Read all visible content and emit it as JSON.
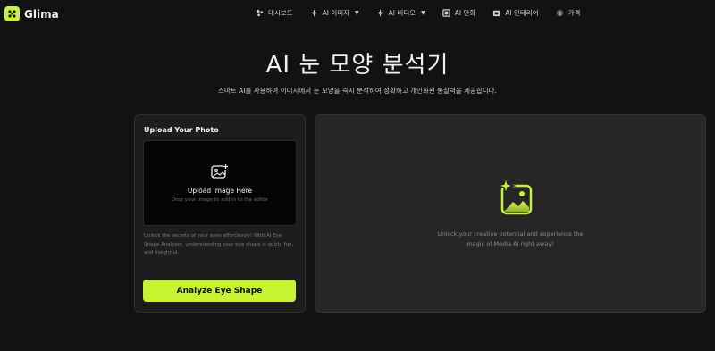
{
  "header": {
    "logo_text": "Glima",
    "nav": [
      {
        "label": "대시보드",
        "icon": "dashboard-icon",
        "dropdown": false
      },
      {
        "label": "AI 이미지",
        "icon": "image-icon",
        "dropdown": true
      },
      {
        "label": "AI 비디오",
        "icon": "video-icon",
        "dropdown": true
      },
      {
        "label": "AI 만화",
        "icon": "comic-icon",
        "dropdown": false
      },
      {
        "label": "AI 인테리어",
        "icon": "interior-icon",
        "dropdown": false
      },
      {
        "label": "가격",
        "icon": "price-icon",
        "dropdown": false
      }
    ]
  },
  "main": {
    "title": "AI 눈 모양 분석기",
    "subtitle": "스마트 AI를 사용하여 이미지에서 눈 모양을 즉시 분석하여 정확하고 개인화된 통찰력을 제공합니다."
  },
  "upload_panel": {
    "title": "Upload Your Photo",
    "dropzone_title": "Upload Image Here",
    "dropzone_hint": "Drop your image to add in to the editor",
    "description": "Unlock the secrets of your eyes effortlessly! With AI Eye Shape Analyzer, understanding your eye shape is quick, fun, and insightful.",
    "button_label": "Analyze Eye Shape"
  },
  "result_panel": {
    "line1": "Unlock your creative potential and experience the",
    "line2": "magic of Media AI right away!"
  },
  "colors": {
    "accent": "#c6f432",
    "background": "#121212",
    "panel_left": "#1d1d1d",
    "panel_right": "#262626"
  }
}
